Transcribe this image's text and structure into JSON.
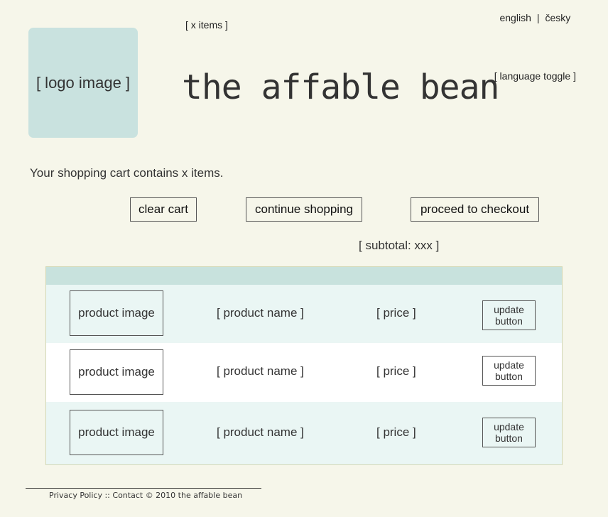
{
  "header": {
    "logo_text": "[ logo image ]",
    "cart_items": "[ x items ]",
    "brand": "the affable bean",
    "language": {
      "english": "english",
      "separator": "|",
      "czech": "česky",
      "toggle": "[ language toggle ]"
    }
  },
  "cart": {
    "message": "Your shopping cart contains x items.",
    "buttons": {
      "clear": "clear cart",
      "continue": "continue shopping",
      "checkout": "proceed to checkout"
    },
    "subtotal": "[ subtotal: xxx ]",
    "rows": [
      {
        "image": "product image",
        "name": "[ product name ]",
        "price": "[ price ]",
        "update_line1": "update",
        "update_line2": "button"
      },
      {
        "image": "product image",
        "name": "[ product name ]",
        "price": "[ price ]",
        "update_line1": "update",
        "update_line2": "button"
      },
      {
        "image": "product image",
        "name": "[ product name ]",
        "price": "[ price ]",
        "update_line1": "update",
        "update_line2": "button"
      }
    ]
  },
  "footer": {
    "privacy": "Privacy Policy",
    "sep1": "::",
    "contact": "Contact",
    "copyright": "©  2010 the affable bean"
  }
}
